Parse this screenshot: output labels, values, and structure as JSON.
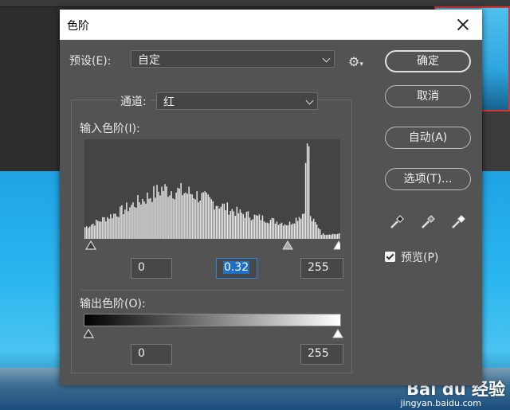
{
  "dialog": {
    "title": "色阶",
    "preset_label": "预设(E):",
    "preset_value": "自定",
    "channel_label": "通道:",
    "channel_value": "红",
    "input_levels_label": "输入色阶(I):",
    "input_black": "0",
    "input_gamma": "0.32",
    "input_white": "255",
    "output_levels_label": "输出色阶(O):",
    "output_black": "0",
    "output_white": "255",
    "buttons": {
      "ok": "确定",
      "cancel": "取消",
      "auto": "自动(A)",
      "options": "选项(T)..."
    },
    "preview_label": "预览(P)",
    "preview_checked": true
  },
  "watermark": {
    "brand": "Bai du 经验",
    "url": "jingyan.baidu.com"
  }
}
